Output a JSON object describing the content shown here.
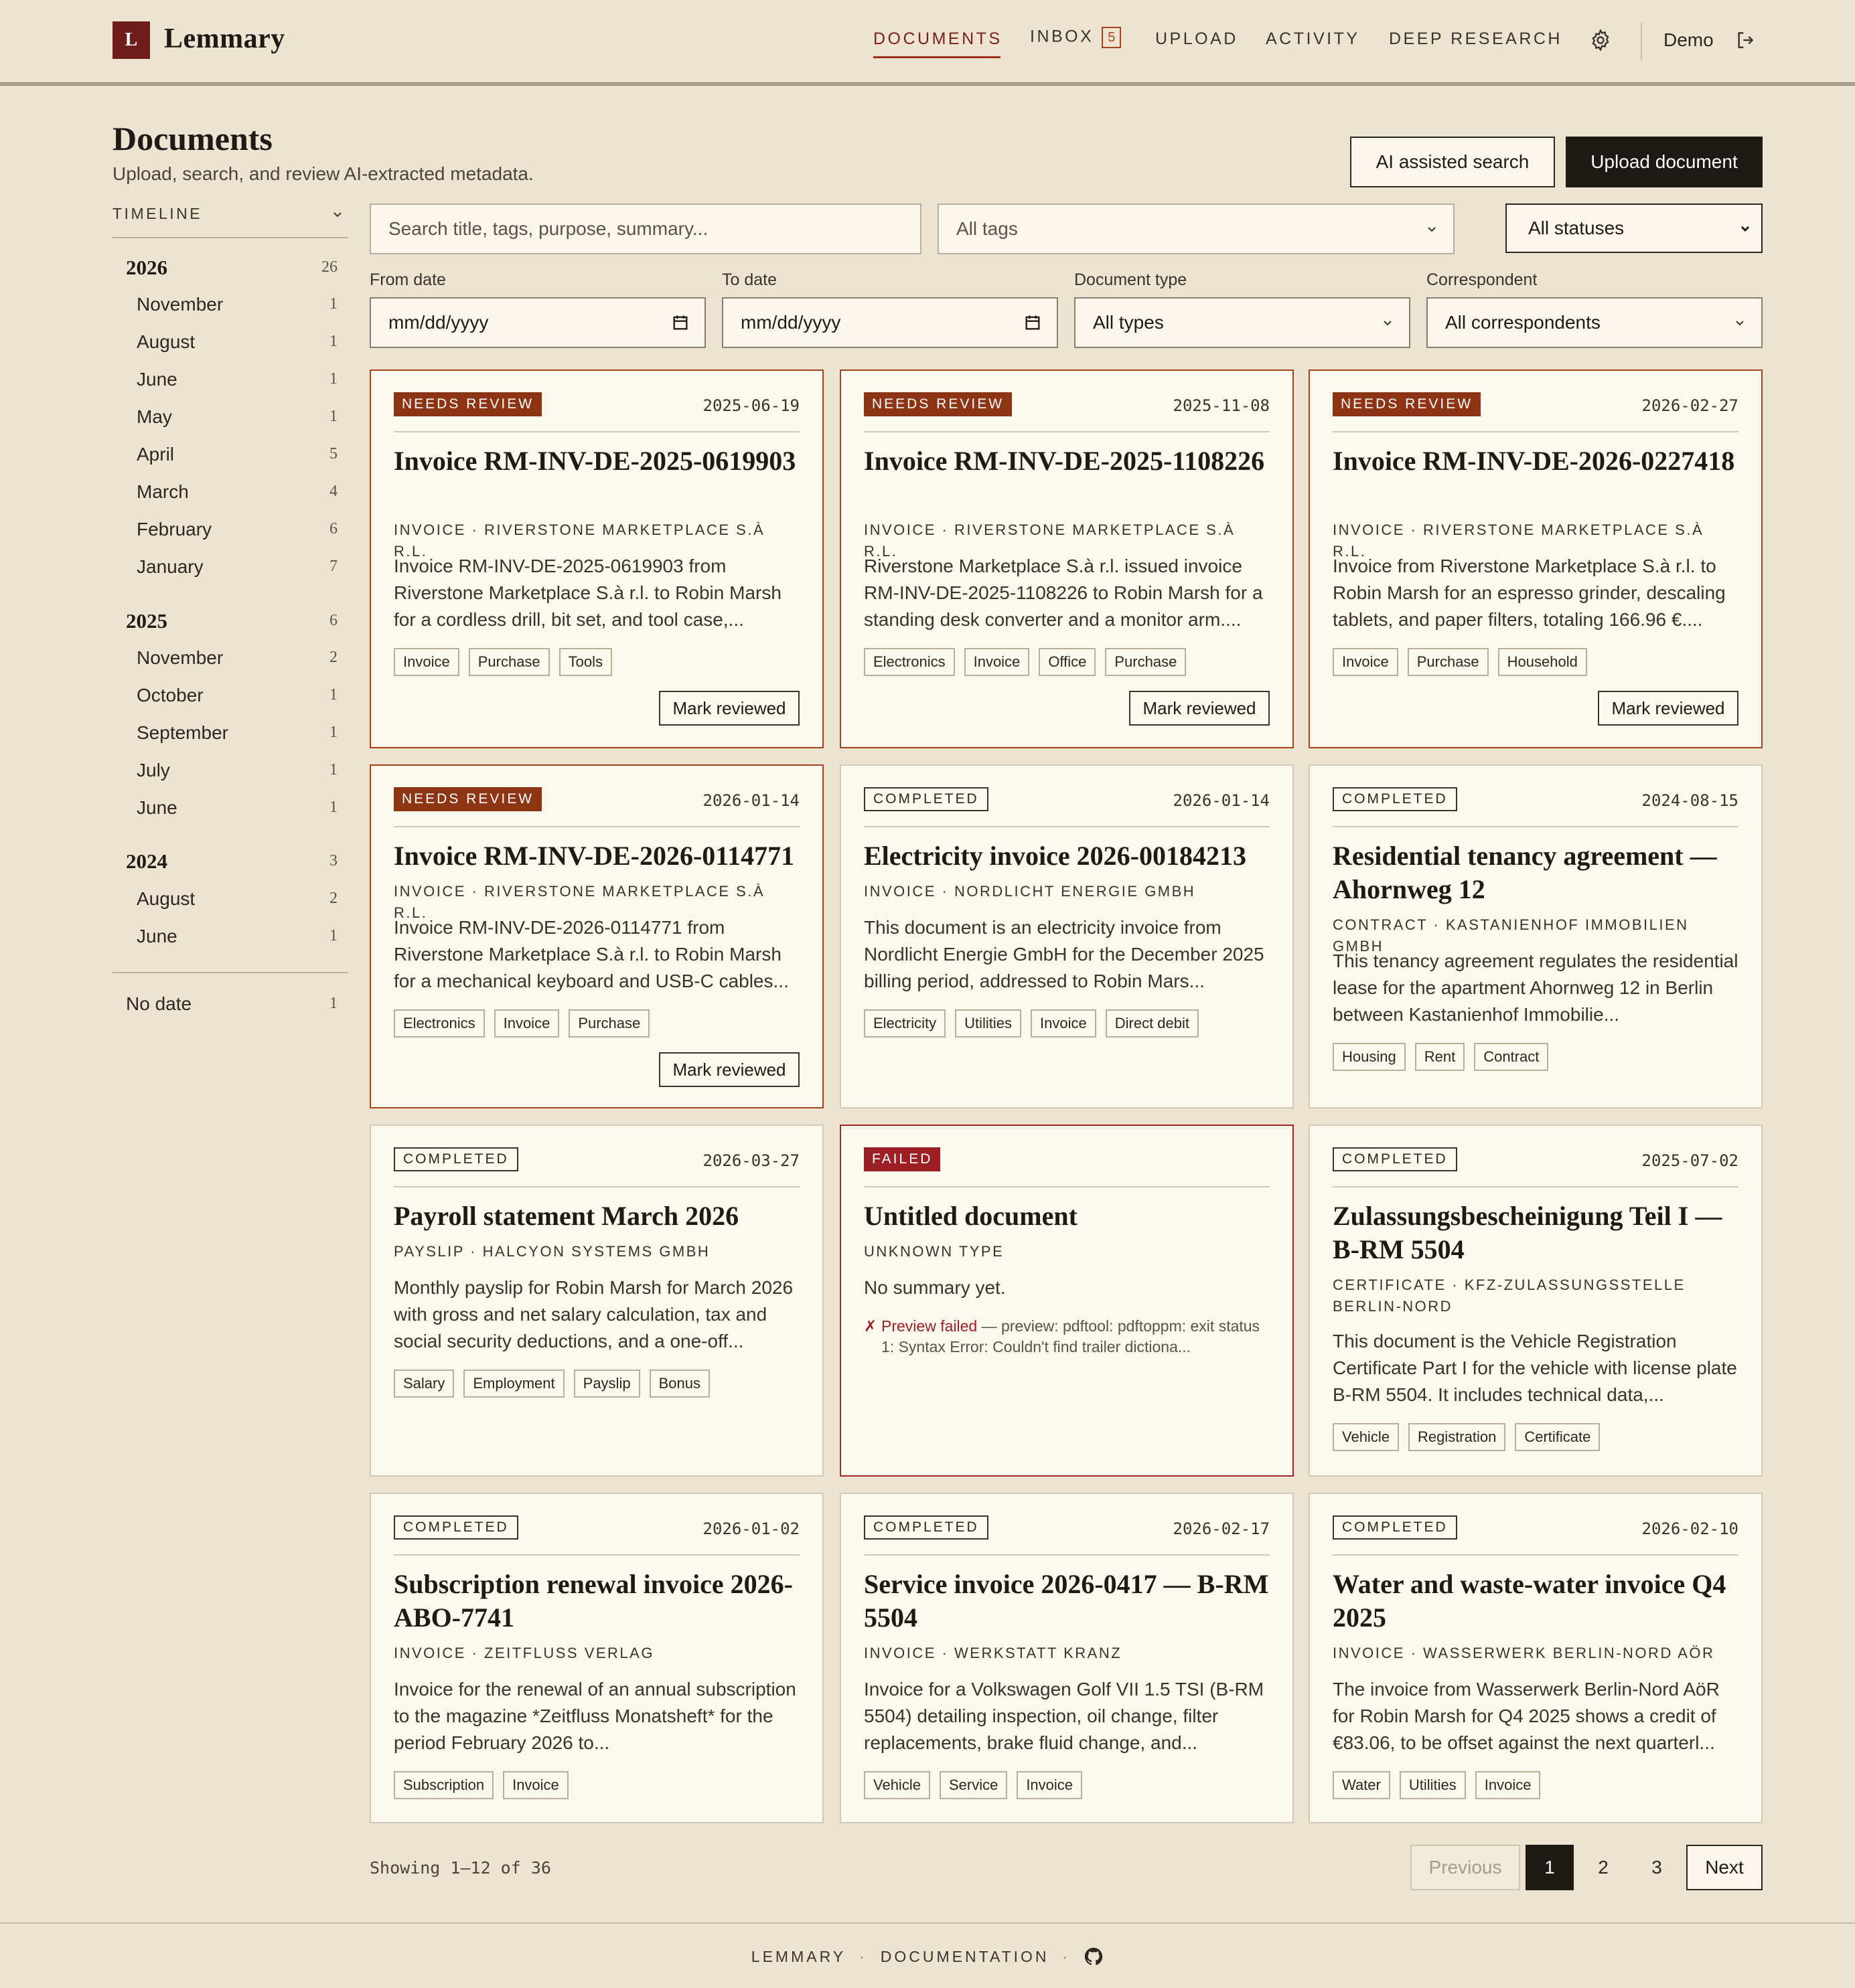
{
  "app": {
    "logo_letter": "L",
    "name": "Lemmary"
  },
  "nav": {
    "documents": "DOCUMENTS",
    "inbox": "INBOX",
    "inbox_count": "5",
    "upload": "UPLOAD",
    "activity": "ACTIVITY",
    "deep_research": "DEEP RESEARCH",
    "settings_icon": "gear-icon",
    "user": "Demo",
    "logout_icon": "logout-icon"
  },
  "page": {
    "title": "Documents",
    "subtitle": "Upload, search, and review AI-extracted metadata.",
    "ai_search": "AI assisted search",
    "upload": "Upload document"
  },
  "timeline": {
    "label": "TIMELINE",
    "years": [
      {
        "year": "2026",
        "count": "26",
        "months": [
          {
            "name": "November",
            "count": "1"
          },
          {
            "name": "August",
            "count": "1"
          },
          {
            "name": "June",
            "count": "1"
          },
          {
            "name": "May",
            "count": "1"
          },
          {
            "name": "April",
            "count": "5"
          },
          {
            "name": "March",
            "count": "4"
          },
          {
            "name": "February",
            "count": "6"
          },
          {
            "name": "January",
            "count": "7"
          }
        ]
      },
      {
        "year": "2025",
        "count": "6",
        "months": [
          {
            "name": "November",
            "count": "2"
          },
          {
            "name": "October",
            "count": "1"
          },
          {
            "name": "September",
            "count": "1"
          },
          {
            "name": "July",
            "count": "1"
          },
          {
            "name": "June",
            "count": "1"
          }
        ]
      },
      {
        "year": "2024",
        "count": "3",
        "months": [
          {
            "name": "August",
            "count": "2"
          },
          {
            "name": "June",
            "count": "1"
          }
        ]
      }
    ],
    "no_date": {
      "label": "No date",
      "count": "1"
    }
  },
  "filters": {
    "search_placeholder": "Search title, tags, purpose, summary...",
    "tags": "All tags",
    "status": "All statuses",
    "from_label": "From date",
    "from_value": "mm/dd/yyyy",
    "to_label": "To date",
    "to_value": "mm/dd/yyyy",
    "type_label": "Document type",
    "type_value": "All types",
    "corr_label": "Correspondent",
    "corr_value": "All correspondents"
  },
  "cards": [
    {
      "status": "NEEDS REVIEW",
      "date": "2025-06-19",
      "title": "Invoice RM-INV-DE-2025-0619903",
      "meta": "INVOICE · RIVERSTONE MARKETPLACE S.À R.L.",
      "summary": "Invoice RM-INV-DE-2025-0619903 from Riverstone Marketplace S.à r.l. to Robin Marsh for a cordless drill, bit set, and tool case,...",
      "tags": [
        "Invoice",
        "Purchase",
        "Tools"
      ],
      "action": "Mark reviewed"
    },
    {
      "status": "NEEDS REVIEW",
      "date": "2025-11-08",
      "title": "Invoice RM-INV-DE-2025-1108226",
      "meta": "INVOICE · RIVERSTONE MARKETPLACE S.À R.L.",
      "summary": "Riverstone Marketplace S.à r.l. issued invoice RM-INV-DE-2025-1108226 to Robin Marsh for a standing desk converter and a monitor arm....",
      "tags": [
        "Electronics",
        "Invoice",
        "Office",
        "Purchase"
      ],
      "action": "Mark reviewed"
    },
    {
      "status": "NEEDS REVIEW",
      "date": "2026-02-27",
      "title": "Invoice RM-INV-DE-2026-0227418",
      "meta": "INVOICE · RIVERSTONE MARKETPLACE S.À R.L.",
      "summary": "Invoice from Riverstone Marketplace S.à r.l. to Robin Marsh for an espresso grinder, descaling tablets, and paper filters, totaling 166.96 €....",
      "tags": [
        "Invoice",
        "Purchase",
        "Household"
      ],
      "action": "Mark reviewed"
    },
    {
      "status": "NEEDS REVIEW",
      "date": "2026-01-14",
      "title": "Invoice RM-INV-DE-2026-0114771",
      "meta": "INVOICE · RIVERSTONE MARKETPLACE S.À R.L.",
      "summary": "Invoice RM-INV-DE-2026-0114771 from Riverstone Marketplace S.à r.l. to Robin Marsh for a mechanical keyboard and USB-C cables...",
      "tags": [
        "Electronics",
        "Invoice",
        "Purchase"
      ],
      "action": "Mark reviewed"
    },
    {
      "status": "COMPLETED",
      "date": "2026-01-14",
      "title": "Electricity invoice 2026-00184213",
      "meta": "INVOICE · NORDLICHT ENERGIE GMBH",
      "summary": "This document is an electricity invoice from Nordlicht Energie GmbH for the December 2025 billing period, addressed to Robin Mars...",
      "tags": [
        "Electricity",
        "Utilities",
        "Invoice",
        "Direct debit"
      ]
    },
    {
      "status": "COMPLETED",
      "date": "2024-08-15",
      "title": "Residential tenancy agreement — Ahornweg 12",
      "meta": "CONTRACT · KASTANIENHOF IMMOBILIEN GMBH",
      "summary": "This tenancy agreement regulates the residential lease for the apartment Ahornweg 12 in Berlin between Kastanienhof Immobilie...",
      "tags": [
        "Housing",
        "Rent",
        "Contract"
      ]
    },
    {
      "status": "COMPLETED",
      "date": "2026-03-27",
      "title": "Payroll statement March 2026",
      "meta": "PAYSLIP · HALCYON SYSTEMS GMBH",
      "summary": "Monthly payslip for Robin Marsh for March 2026 with gross and net salary calculation, tax and social security deductions, and a one-off...",
      "tags": [
        "Salary",
        "Employment",
        "Payslip",
        "Bonus"
      ]
    },
    {
      "status": "FAILED",
      "date": "",
      "title": "Untitled document",
      "meta": "UNKNOWN TYPE",
      "summary": "No summary yet.",
      "error_mark": "✗",
      "error_label": "Preview failed",
      "error_text": " — preview: pdftool: pdftoppm: exit status 1: Syntax Error: Couldn't find trailer dictiona...",
      "tags": []
    },
    {
      "status": "COMPLETED",
      "date": "2025-07-02",
      "title": "Zulassungsbescheinigung Teil I — B-RM 5504",
      "meta": "CERTIFICATE · KFZ-ZULASSUNGSSTELLE BERLIN-NORD",
      "summary": "This document is the Vehicle Registration Certificate Part I for the vehicle with license plate B-RM 5504. It includes technical data,...",
      "tags": [
        "Vehicle",
        "Registration",
        "Certificate"
      ]
    },
    {
      "status": "COMPLETED",
      "date": "2026-01-02",
      "title": "Subscription renewal invoice 2026-ABO-7741",
      "meta": "INVOICE · ZEITFLUSS VERLAG",
      "summary": "Invoice for the renewal of an annual subscription to the magazine *Zeitfluss Monatsheft* for the period February 2026 to...",
      "tags": [
        "Subscription",
        "Invoice"
      ]
    },
    {
      "status": "COMPLETED",
      "date": "2026-02-17",
      "title": "Service invoice 2026-0417 — B-RM 5504",
      "meta": "INVOICE · WERKSTATT KRANZ",
      "summary": "Invoice for a Volkswagen Golf VII 1.5 TSI (B-RM 5504) detailing inspection, oil change, filter replacements, brake fluid change, and...",
      "tags": [
        "Vehicle",
        "Service",
        "Invoice"
      ]
    },
    {
      "status": "COMPLETED",
      "date": "2026-02-10",
      "title": "Water and waste-water invoice Q4 2025",
      "meta": "INVOICE · WASSERWERK BERLIN-NORD AÖR",
      "summary": "The invoice from Wasserwerk Berlin-Nord AöR for Robin Marsh for Q4 2025 shows a credit of €83.06, to be offset against the next quarterl...",
      "tags": [
        "Water",
        "Utilities",
        "Invoice"
      ]
    }
  ],
  "pagination": {
    "showing": "Showing 1–12 of 36",
    "previous": "Previous",
    "p1": "1",
    "p2": "2",
    "p3": "3",
    "next": "Next"
  },
  "footer": {
    "brand": "LEMMARY",
    "sep": "·",
    "docs": "DOCUMENTATION",
    "github_icon": "github-icon"
  },
  "colors": {
    "background": "#ece4d1",
    "brand": "#6e1d1a",
    "review": "#8c3414",
    "failed": "#9b1f24",
    "dark_button": "#1d1a16"
  }
}
